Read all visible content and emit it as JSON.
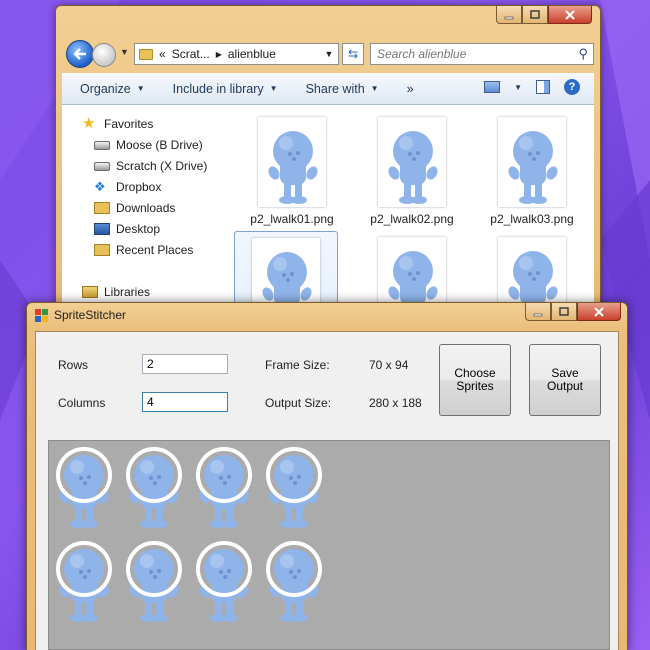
{
  "explorer": {
    "breadcrumb": {
      "overflow": "«",
      "segments": [
        "Scrat...",
        "alienblue"
      ]
    },
    "search": {
      "placeholder": "Search alienblue"
    },
    "toolbar": {
      "organize": "Organize",
      "include_in_library": "Include in library",
      "share_with": "Share with",
      "burn": "»"
    },
    "nav_pane": {
      "favorites_label": "Favorites",
      "items": [
        {
          "label": "Moose (B Drive)",
          "icon": "drive-icon"
        },
        {
          "label": "Scratch (X Drive)",
          "icon": "drive-icon"
        },
        {
          "label": "Dropbox",
          "icon": "dropbox-icon"
        },
        {
          "label": "Downloads",
          "icon": "downloads-folder-icon"
        },
        {
          "label": "Desktop",
          "icon": "desktop-icon"
        },
        {
          "label": "Recent Places",
          "icon": "recent-places-icon"
        }
      ],
      "libraries_label": "Libraries"
    },
    "files": [
      {
        "name": "p2_lwalk01.png",
        "selected": false
      },
      {
        "name": "p2_lwalk02.png",
        "selected": false
      },
      {
        "name": "p2_lwalk03.png",
        "selected": false
      },
      {
        "name": "",
        "selected": true
      },
      {
        "name": "",
        "selected": false
      },
      {
        "name": "",
        "selected": false
      }
    ]
  },
  "stitcher": {
    "title": "SpriteStitcher",
    "rows_label": "Rows",
    "rows_value": "2",
    "columns_label": "Columns",
    "columns_value": "4",
    "frame_size_label": "Frame Size:",
    "frame_size_value": "70 x 94",
    "output_size_label": "Output Size:",
    "output_size_value": "280 x 188",
    "choose_button": "Choose Sprites",
    "save_button": "Save Output",
    "grid": {
      "rows": 2,
      "columns": 4
    }
  },
  "colors": {
    "desktop_bg": "#7a4de8",
    "window_frame": "#ebbf7d",
    "alien_body": "#8fb4ea",
    "canvas_bg": "#ababab"
  }
}
